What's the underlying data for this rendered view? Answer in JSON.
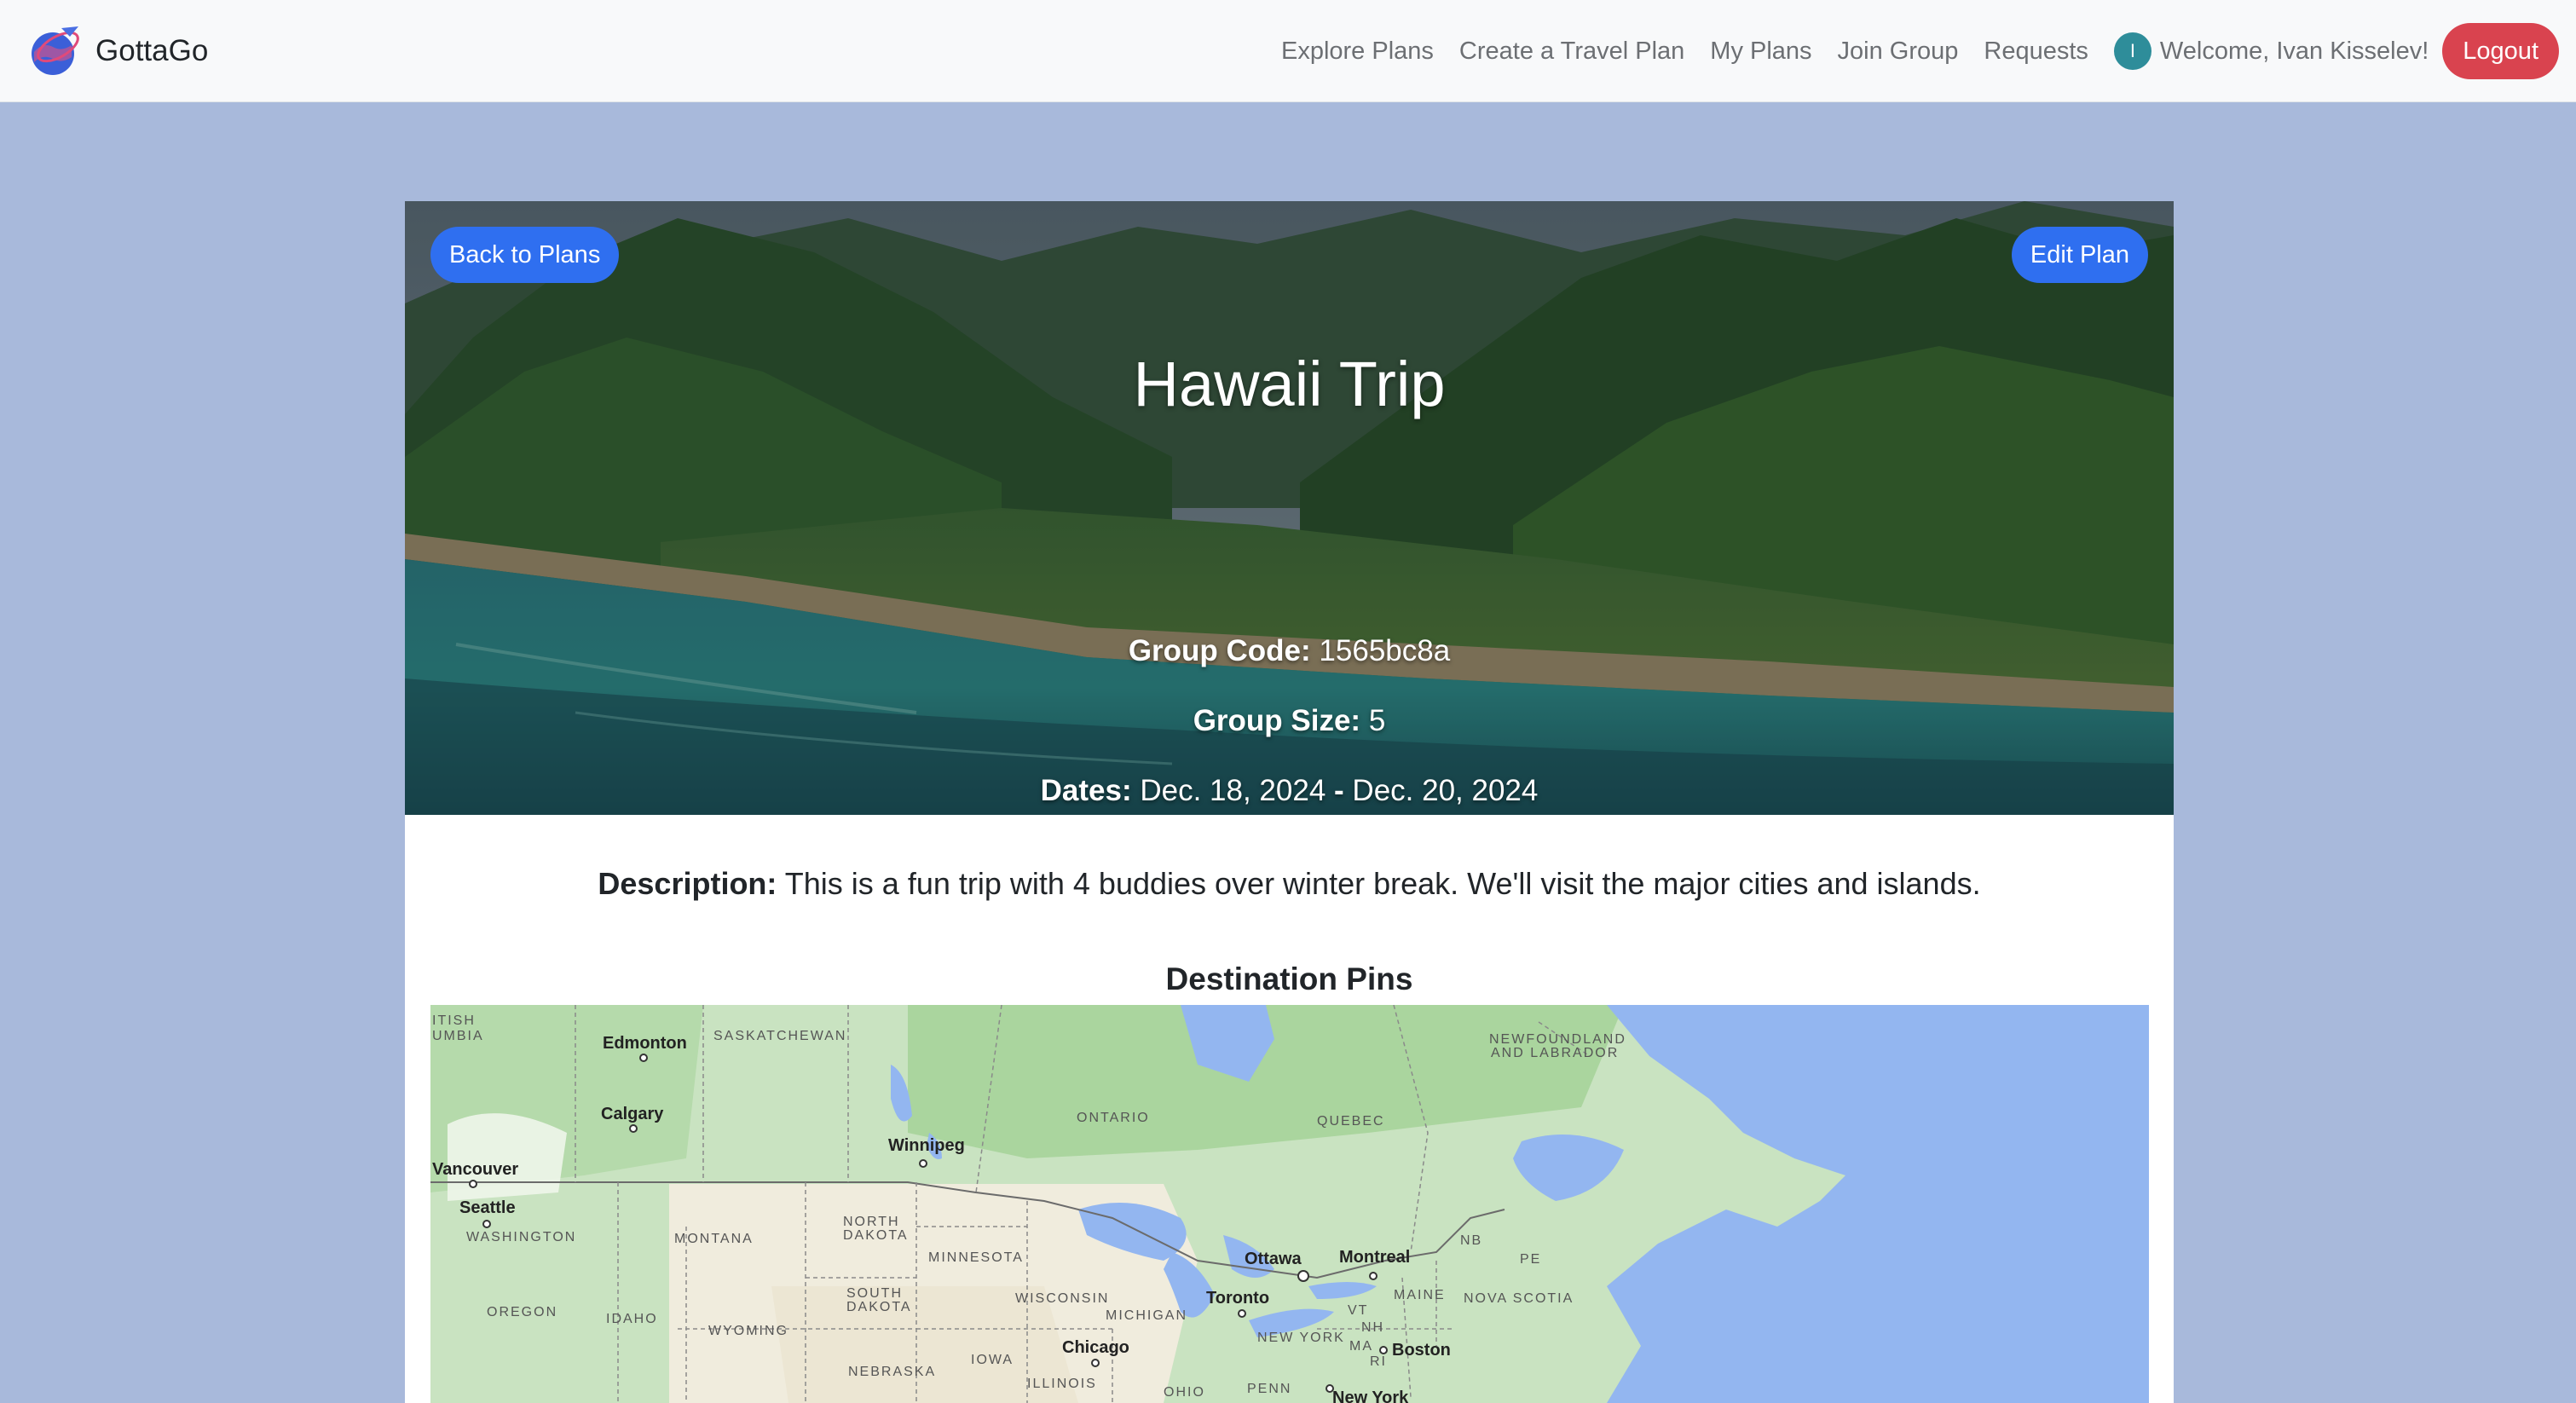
{
  "app": {
    "brand_name": "GottaGo",
    "logo_icon": "globe-plane-icon"
  },
  "nav": {
    "links": [
      "Explore Plans",
      "Create a Travel Plan",
      "My Plans",
      "Join Group",
      "Requests"
    ],
    "avatar_initial": "I",
    "welcome": "Welcome, Ivan Kisselev!",
    "logout": "Logout"
  },
  "plan": {
    "back_label": "Back to Plans",
    "edit_label": "Edit Plan",
    "title": "Hawaii Trip",
    "group_code_label": "Group Code:",
    "group_code": "1565bc8a",
    "group_size_label": "Group Size:",
    "group_size": "5",
    "dates_label": "Dates:",
    "start_date": "Dec. 18, 2024",
    "date_sep": "-",
    "end_date": "Dec. 20, 2024",
    "description_label": "Description:",
    "description": "This is a fun trip with 4 buddies over winter break. We'll visit the major cities and islands."
  },
  "map": {
    "title": "Destination Pins",
    "cities": [
      "Edmonton",
      "Calgary",
      "Winnipeg",
      "Vancouver",
      "Seattle",
      "Ottawa",
      "Montreal",
      "Toronto",
      "Chicago",
      "Boston",
      "New York"
    ],
    "regions": [
      "ITISH",
      "UMBIA",
      "SASKATCHEWAN",
      "NEWFOUNDLAND",
      "AND LABRADOR",
      "ONTARIO",
      "QUEBEC",
      "WASHINGTON",
      "MONTANA",
      "NORTH",
      "DAKOTA",
      "MINNESOTA",
      "NB",
      "PE",
      "SOUTH",
      "DAKOTA",
      "WISCONSIN",
      "MAINE",
      "NOVA SCOTIA",
      "OREGON",
      "IDAHO",
      "WYOMING",
      "MICHIGAN",
      "VT",
      "NH",
      "NEW YORK",
      "MA",
      "RI",
      "NEBRASKA",
      "IOWA",
      "ILLINOIS",
      "OHIO",
      "PENN"
    ]
  },
  "colors": {
    "page_bg": "#a8b9db",
    "nav_bg": "#f8f9fa",
    "primary": "#2f6ff0",
    "danger": "#d9434f",
    "avatar": "#2e8d9a"
  }
}
